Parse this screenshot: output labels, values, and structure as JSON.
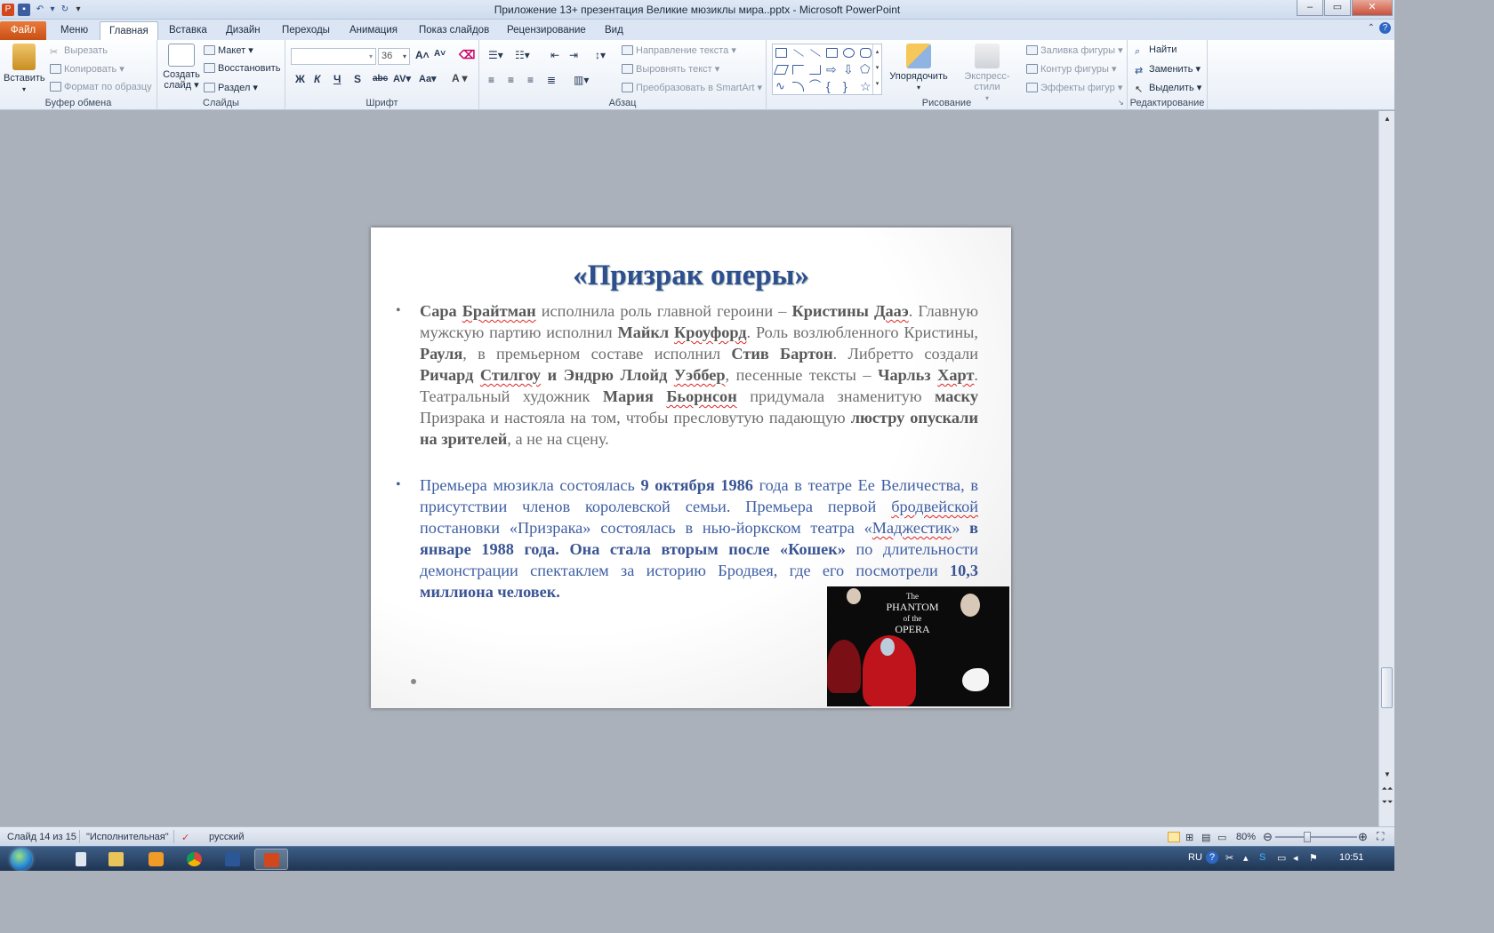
{
  "window": {
    "title": "Приложение 13+ презентация Великие мюзиклы мира..pptx  -  Microsoft PowerPoint"
  },
  "tabs": {
    "file": "Файл",
    "items": [
      "Меню",
      "Главная",
      "Вставка",
      "Дизайн",
      "Переходы",
      "Анимация",
      "Показ слайдов",
      "Рецензирование",
      "Вид"
    ],
    "active": "Главная"
  },
  "ribbon": {
    "clipboard": {
      "label": "Буфер обмена",
      "paste": "Вставить",
      "cut": "Вырезать",
      "copy": "Копировать",
      "format_painter": "Формат по образцу"
    },
    "slides": {
      "label": "Слайды",
      "new_slide_1": "Создать",
      "new_slide_2": "слайд",
      "layout": "Макет",
      "reset": "Восстановить",
      "section": "Раздел"
    },
    "font": {
      "label": "Шрифт",
      "size": "36"
    },
    "paragraph": {
      "label": "Абзац",
      "text_direction": "Направление текста",
      "align_text": "Выровнять текст",
      "smartart": "Преобразовать в SmartArt"
    },
    "drawing": {
      "label": "Рисование",
      "arrange": "Упорядочить",
      "quick_styles": "Экспресс-стили",
      "shape_fill": "Заливка фигуры",
      "shape_outline": "Контур фигуры",
      "shape_effects": "Эффекты фигур"
    },
    "editing": {
      "label": "Редактирование",
      "find": "Найти",
      "replace": "Заменить",
      "select": "Выделить"
    }
  },
  "slide": {
    "title": "«Призрак оперы»",
    "p1": {
      "t1": "Сара",
      "t2": "Брайтман",
      "t3": "исполнила роль главной героини –",
      "t4": "Кристины",
      "t5": "Дааэ",
      "t6": ". Главную мужскую партию исполнил",
      "t7": "Майкл",
      "t8": "Кроуфорд",
      "t9": ". Роль возлюбленного Кристины,",
      "t10": "Рауля",
      "t11": ", в премьерном составе исполнил",
      "t12": "Стив Бартон",
      "t13": ". Либретто создали",
      "t14": "Ричард",
      "t15": "Стилгоу",
      "t16": "и Эндрю Ллойд",
      "t17": "Уэббер",
      "t18": ", песенные тексты –",
      "t19": "Чарльз",
      "t20": "Харт",
      "t21": ". Театральный художник",
      "t22": "Мария",
      "t23": "Бьорнсон",
      "t24": "придумала знаменитую",
      "t25": "маску",
      "t26": "Призрака и настояла на том, чтобы пресловутую падающую",
      "t27": "люстру опускали на зрителей",
      "t28": ", а не на сцену."
    },
    "p2": {
      "t1": "Премьера мюзикла состоялась",
      "t2": "9 октября 1986",
      "t3": "года в театре Ее Величества, в присутствии членов королевской семьи. Премьера первой",
      "t4": "бродвейской",
      "t5": "постановки «Призрака» состоялась в нью-йоркском театра «",
      "t6": "Маджестик",
      "t7": "»",
      "t8": "в январе 1988 года. Она стала вторым после «Кошек»",
      "t9": "по длительности демонстрации спектаклем за историю Бродвея, где его посмотрели",
      "t10": "10,3 миллиона человек."
    },
    "poster": {
      "line1": "The",
      "line2": "PHANTOM",
      "line3": "of the",
      "line4": "OPERA"
    }
  },
  "status": {
    "slide_info": "Слайд 14 из 15",
    "theme": "\"Исполнительная\"",
    "language": "русский",
    "zoom": "80%"
  },
  "taskbar": {
    "lang": "RU",
    "time": "10:51"
  }
}
